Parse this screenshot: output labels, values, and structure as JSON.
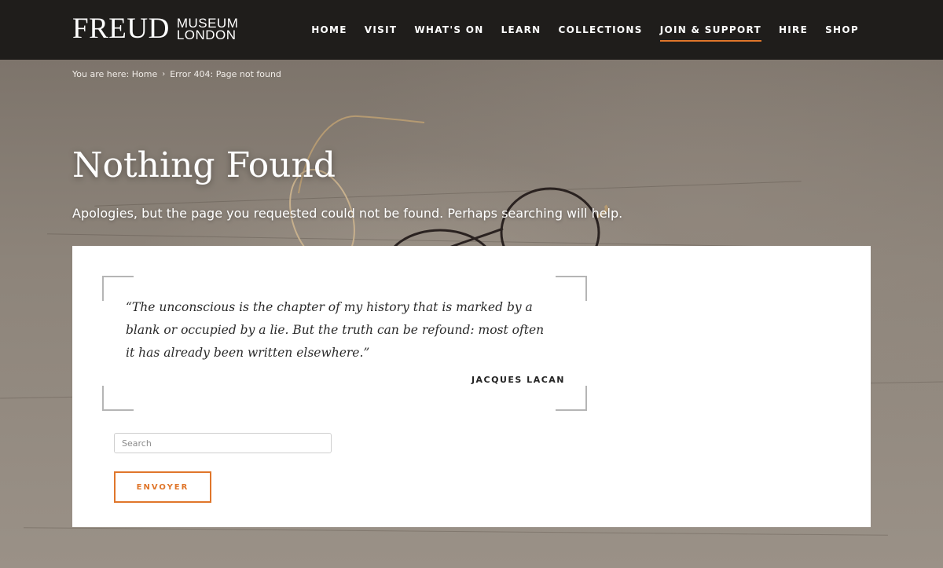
{
  "header": {
    "logo": {
      "main": "FREUD",
      "sub_top": "MUSEUM",
      "sub_bottom": "LONDON"
    },
    "nav": [
      {
        "label": "HOME",
        "active": false
      },
      {
        "label": "VISIT",
        "active": false
      },
      {
        "label": "WHAT'S ON",
        "active": false
      },
      {
        "label": "LEARN",
        "active": false
      },
      {
        "label": "COLLECTIONS",
        "active": false
      },
      {
        "label": "JOIN & SUPPORT",
        "active": true
      },
      {
        "label": "HIRE",
        "active": false
      },
      {
        "label": "SHOP",
        "active": false
      }
    ]
  },
  "breadcrumb": {
    "prefix": "You are here:",
    "home": "Home",
    "separator_icon": "chevron-right-icon",
    "current": "Error 404: Page not found"
  },
  "page": {
    "title": "Nothing Found",
    "message": "Apologies, but the page you requested could not be found. Perhaps searching will help."
  },
  "quote": {
    "text": "“The unconscious is the chapter of my history that is marked by a blank or occupied by a lie. But the truth can be refound: most often it has already been written elsewhere.”",
    "author": "JACQUES LACAN"
  },
  "search": {
    "placeholder": "Search",
    "value": "",
    "button_label": "ENVOYER"
  },
  "colors": {
    "header_bg": "#1f1d1b",
    "accent": "#e0762b",
    "panel_bg": "#ffffff",
    "text_dark": "#2a2a2a"
  }
}
